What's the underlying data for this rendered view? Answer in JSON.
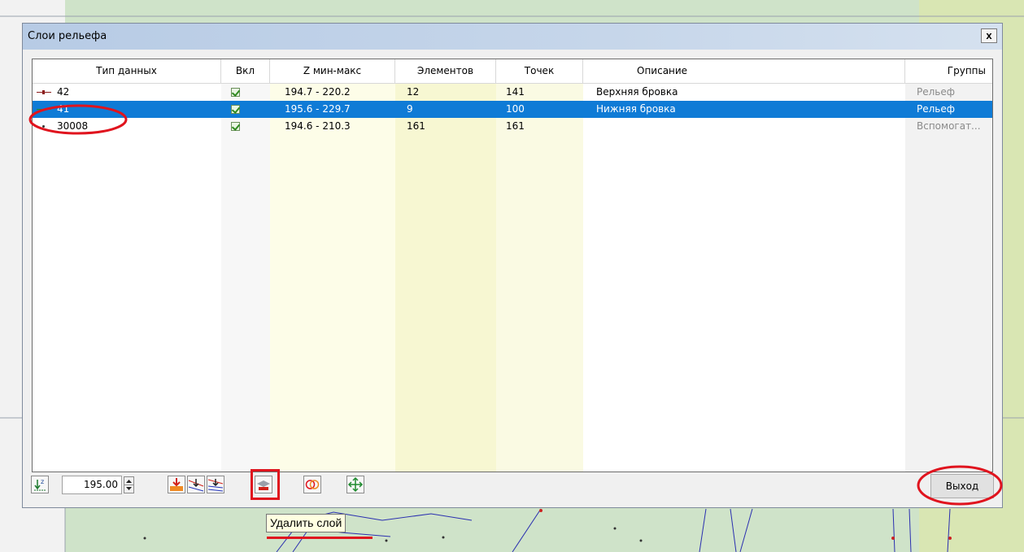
{
  "dialog": {
    "title": "Слои рельефа",
    "close_label": "x"
  },
  "table": {
    "headers": {
      "type": "Тип данных",
      "on": "Вкл",
      "z": "Z мин-макс",
      "elements": "Элементов",
      "points": "Точек",
      "description": "Описание",
      "groups": "Группы"
    },
    "rows": [
      {
        "type": "42",
        "on": true,
        "z": "194.7 - 220.2",
        "elements": "12",
        "points": "141",
        "description": "Верхняя бровка",
        "group": "Рельеф",
        "line_color": "#8b1a1a"
      },
      {
        "type": "41",
        "on": true,
        "z": "195.6 - 229.7",
        "elements": "9",
        "points": "100",
        "description": "Нижняя бровка",
        "group": "Рельеф",
        "line_color": "#2a8a2a",
        "selected": true
      },
      {
        "type": "30008",
        "on": true,
        "z": "194.6 - 210.3",
        "elements": "161",
        "points": "161",
        "description": "",
        "group": "Вспомогат..."
      }
    ]
  },
  "toolbar": {
    "level_value": "195.00",
    "exit_label": "Выход",
    "tooltip": "Удалить слой"
  },
  "colors": {
    "selection": "#0f7bd6",
    "annotation_red": "#e0141e"
  }
}
